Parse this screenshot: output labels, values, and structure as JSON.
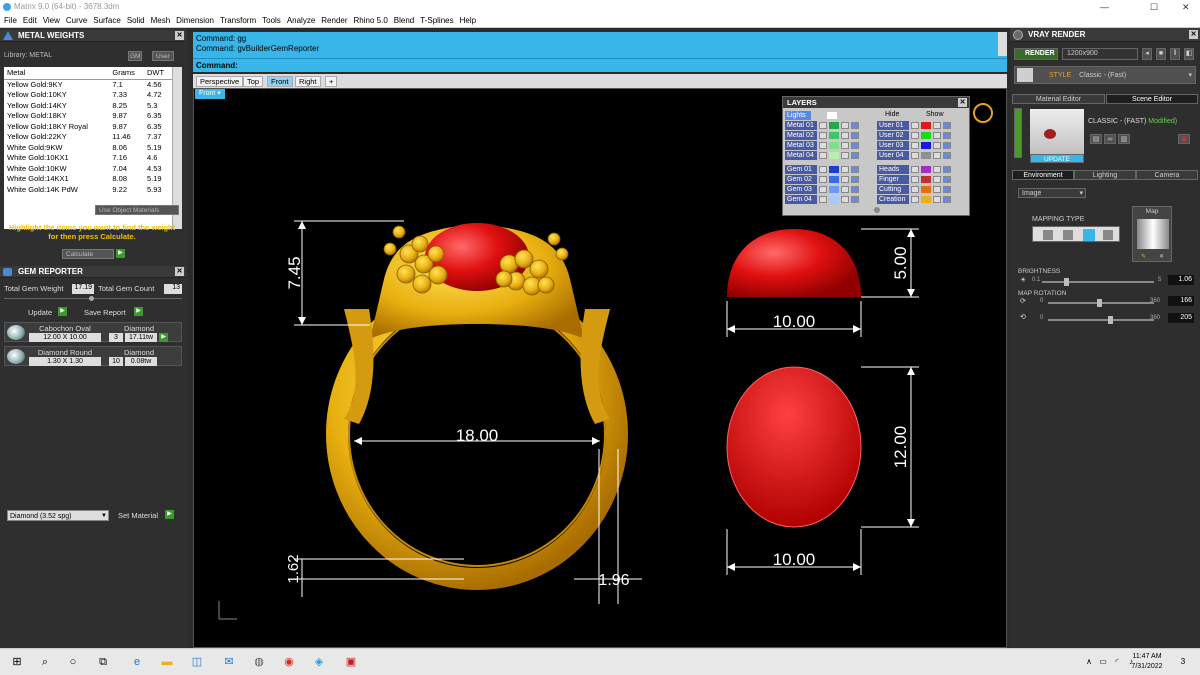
{
  "window": {
    "title": "Matrix 9.0 (64-bit) - 3678.3dm",
    "min": "—",
    "max": "☐",
    "close": "✕"
  },
  "menu": [
    "File",
    "Edit",
    "View",
    "Curve",
    "Surface",
    "Solid",
    "Mesh",
    "Dimension",
    "Transform",
    "Tools",
    "Analyze",
    "Render",
    "Rhino 5.0",
    "Blend",
    "T-Splines",
    "Help"
  ],
  "metal_weights": {
    "title": "METAL WEIGHTS",
    "library_label": "Library: METAL",
    "tab_gm": "GM",
    "tab_user": "User",
    "columns": [
      "Metal",
      "Grams",
      "DWT"
    ],
    "rows": [
      [
        "Yellow Gold:9KY",
        "7.1",
        "4.56"
      ],
      [
        "Yellow Gold:10KY",
        "7.33",
        "4.72"
      ],
      [
        "Yellow Gold:14KY",
        "8.25",
        "5.3"
      ],
      [
        "Yellow Gold:18KY",
        "9.87",
        "6.35"
      ],
      [
        "Yellow Gold:18KY Royal",
        "9.87",
        "6.35"
      ],
      [
        "Yellow Gold:22KY",
        "11.46",
        "7.37"
      ],
      [
        "White Gold:9KW",
        "8.06",
        "5.19"
      ],
      [
        "White Gold:10KX1",
        "7.16",
        "4.6"
      ],
      [
        "White Gold:10KW",
        "7.04",
        "4.53"
      ],
      [
        "White Gold:14KX1",
        "8.08",
        "5.19"
      ],
      [
        "White Gold:14K PdW",
        "9.22",
        "5.93"
      ]
    ],
    "use_object_materials": "Use Object Materials",
    "hint": "Highlight the items you want to find the weight for then press Calculate.",
    "calculate": "Calculate"
  },
  "gem_reporter": {
    "title": "GEM REPORTER",
    "total_weight_label": "Total Gem Weight",
    "total_weight": "17.19",
    "total_count_label": "Total Gem Count",
    "total_count": "13",
    "update": "Update",
    "save_report": "Save Report",
    "gems": [
      {
        "shape": "Cabochon Oval",
        "size": "12.00 X 10.00",
        "material": "Diamond",
        "count": "3",
        "weight": "17.11tw"
      },
      {
        "shape": "Diamond Round",
        "size": "1.30 X 1.30",
        "material": "Diamond",
        "count": "10",
        "weight": "0.08tw"
      }
    ],
    "material_select": "Diamond    (3.52 spg)",
    "set_material": "Set Material"
  },
  "command": {
    "lines": [
      "Command: gg",
      "Command: gvBuilderGemReporter"
    ],
    "prompt": "Command:"
  },
  "viewport_tabs": [
    "Perspective",
    "Top",
    "Front",
    "Right"
  ],
  "active_tab": "Front",
  "viewport_label": "Front",
  "dimensions": {
    "ring_top_height": "7.45",
    "ring_inner_diameter": "18.00",
    "ring_bottom": "1.62",
    "shank_width": "1.96",
    "gem_side_height": "5.00",
    "gem_side_width": "10.00",
    "gem_top_length": "12.00",
    "gem_top_width": "10.00"
  },
  "layers": {
    "title": "LAYERS",
    "lights": "Lights",
    "hide": "Hide",
    "show": "Show",
    "left": [
      {
        "name": "Metal 01",
        "color": "#22a84a"
      },
      {
        "name": "Metal 02",
        "color": "#3ec46a"
      },
      {
        "name": "Metal 03",
        "color": "#7ee08a"
      },
      {
        "name": "Metal 04",
        "color": "#b8f0b0"
      },
      {
        "name": "Gem 01",
        "color": "#1e3cd0"
      },
      {
        "name": "Gem 02",
        "color": "#3a6af0"
      },
      {
        "name": "Gem 03",
        "color": "#6a9af8"
      },
      {
        "name": "Gem 04",
        "color": "#a8c8ff"
      }
    ],
    "right": [
      {
        "name": "User 01",
        "color": "#e01818"
      },
      {
        "name": "User 02",
        "color": "#18d818"
      },
      {
        "name": "User 03",
        "color": "#1818e0"
      },
      {
        "name": "User 04",
        "color": "#909090"
      },
      {
        "name": "Heads",
        "color": "#a030c0"
      },
      {
        "name": "Finger",
        "color": "#c03030"
      },
      {
        "name": "Cutting",
        "color": "#e07010"
      },
      {
        "name": "Creation",
        "color": "#e8b020"
      }
    ]
  },
  "vray": {
    "title": "VRAY RENDER",
    "render": "RENDER",
    "resolution": "1200x900",
    "style_label": "STYLE",
    "style_value": "Classic - (Fast)",
    "tab_material": "Material Editor",
    "tab_scene": "Scene Editor",
    "preset_name": "CLASSIC - (FAST)",
    "preset_modified": "Modified)",
    "update": "UPDATE",
    "sub_tabs": [
      "Environment",
      "Lighting",
      "Camera"
    ],
    "env_select": "Image",
    "mapping_type": "MAPPING TYPE",
    "map_label": "Map",
    "brightness_label": "BRIGHTNESS",
    "brightness_min": "0.1",
    "brightness_max": "5",
    "brightness_value": "1.06",
    "brightness_level": 0.2,
    "map_rotation_label": "MAP ROTATION",
    "rot1_min": "0",
    "rot1_max": "360",
    "rot1_value": "166",
    "rot1_level": 0.46,
    "rot2_min": "0",
    "rot2_max": "360",
    "rot2_value": "205",
    "rot2_level": 0.57
  },
  "taskbar": {
    "time": "11:47 AM",
    "date": "7/31/2022",
    "notif": "3"
  }
}
